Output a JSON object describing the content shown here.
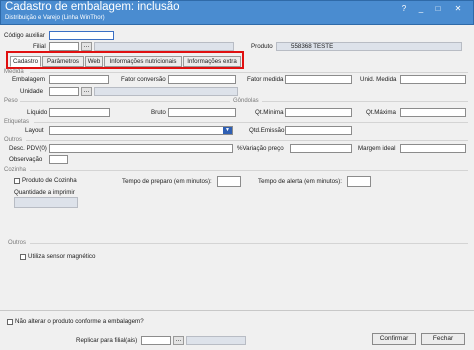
{
  "window": {
    "title": "Cadastro de embalagem: inclusão",
    "subtitle": "Distribuição e Varejo (Linha WinThor)",
    "controls": [
      "?",
      "_",
      "□",
      "✕"
    ]
  },
  "header": {
    "codigo_auxiliar_label": "Código auxiliar",
    "filial_label": "Filial",
    "filial_button": "...",
    "produto_label": "Produto",
    "produto_value": "558368 TESTE"
  },
  "tabs": [
    "Cadastro",
    "Parâmetros",
    "Web",
    "Informações nutricionais",
    "Informações extra"
  ],
  "sections": {
    "medida": "Medida",
    "peso": "Peso",
    "gondolas": "Gôndolas",
    "etiquetas": "Etiquetas",
    "outros": "Outros",
    "cozinha": "Cozinha",
    "outros2": "Outros"
  },
  "fields": {
    "embalagem": "Embalagem",
    "fator_conversao": "Fator conversão",
    "fator_medida": "Fator medida",
    "unid_medida": "Unid. Medida",
    "unidade": "Unidade",
    "unidade_button": "...",
    "liquido": "Líquido",
    "bruto": "Bruto",
    "qt_minima": "Qt.Mínima",
    "qt_maxima": "Qt.Máxima",
    "layout": "Layout",
    "qtd_emissao": "Qtd.Emissão",
    "desc_pdv": "Desc. PDV(0)",
    "variacao_preco": "%Variação preço",
    "margem_ideal": "Margem ideal",
    "observacao": "Observação",
    "produto_cozinha": "Produto de Cozinha",
    "tempo_preparo": "Tempo de preparo (em minutos):",
    "tempo_alerta": "Tempo de alerta (em minutos):",
    "quantidade_imprimir": "Quantidade a imprimir",
    "utiliza_sensor": "Utiliza sensor magnético",
    "nao_alterar": "Não alterar o produto conforme a embalagem?",
    "replicar": "Replicar para filial(ais)",
    "replicar_button": "..."
  },
  "buttons": {
    "confirmar": "Confirmar",
    "fechar": "Fechar"
  },
  "colors": {
    "titlebar": "#4a8cd0",
    "highlight": "#e01010",
    "dropdown_arrow": "#2f5fb3"
  }
}
